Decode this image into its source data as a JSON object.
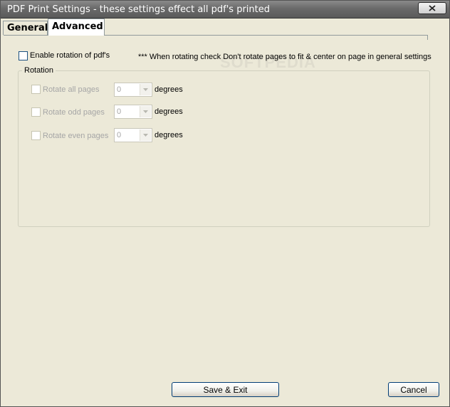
{
  "window": {
    "title": "PDF Print Settings - these settings effect all pdf's printed"
  },
  "tabs": [
    {
      "label": "General",
      "selected": false
    },
    {
      "label": "Advanced",
      "selected": true
    }
  ],
  "advanced": {
    "enable_rotation": {
      "label": "Enable rotation of pdf's",
      "checked": false
    },
    "note": "*** When rotating check Don't rotate pages to fit & center on page in general settings",
    "rotation_group": {
      "label": "Rotation",
      "rows": [
        {
          "label": "Rotate all pages",
          "value": "0",
          "unit": "degrees"
        },
        {
          "label": "Rotate odd pages",
          "value": "0",
          "unit": "degrees"
        },
        {
          "label": "Rotate even pages",
          "value": "0",
          "unit": "degrees"
        }
      ]
    }
  },
  "buttons": {
    "save_label": "Save & Exit",
    "cancel_label": "Cancel"
  },
  "icons": {
    "close": "close-icon",
    "dropdown": "chevron-down-icon"
  },
  "colors": {
    "titlebar": "#6a6a6a",
    "dialog_bg": "#ece9d8",
    "button_border": "#003c74"
  }
}
